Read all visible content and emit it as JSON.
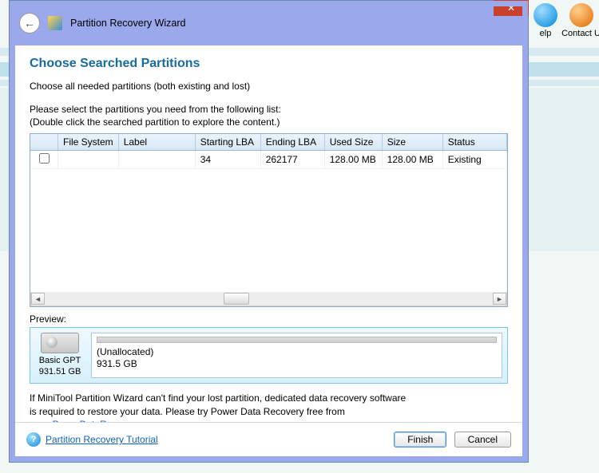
{
  "background": {
    "help_label": "elp",
    "contact_label": "Contact U"
  },
  "window": {
    "title": "Partition Recovery Wizard"
  },
  "page": {
    "heading": "Choose Searched Partitions",
    "instruction": "Choose all needed partitions (both existing and lost)",
    "sub1": "Please select the partitions you need from the following list:",
    "sub2": "(Double click the searched partition to explore the content.)"
  },
  "table": {
    "headers": [
      "",
      "File System",
      "Label",
      "Starting LBA",
      "Ending LBA",
      "Used Size",
      "Size",
      "Status"
    ],
    "rows": [
      {
        "checked": false,
        "filesystem": "",
        "label": "",
        "start_lba": "34",
        "end_lba": "262177",
        "used": "128.00 MB",
        "size": "128.00 MB",
        "status": "Existing"
      }
    ]
  },
  "preview": {
    "label": "Preview:",
    "disk_type": "Basic GPT",
    "disk_size": "931.51 GB",
    "region_name": "(Unallocated)",
    "region_size": "931.5 GB"
  },
  "hint": {
    "text_before": "If MiniTool Partition Wizard can't find your lost partition, dedicated data recovery software is required to restore your data. Please try Power Data Recovery free from ",
    "link_text": "www.PowerDataRecovery.com",
    "text_after": "."
  },
  "footer": {
    "tutorial_link": "Partition Recovery Tutorial",
    "finish": "Finish",
    "cancel": "Cancel"
  }
}
